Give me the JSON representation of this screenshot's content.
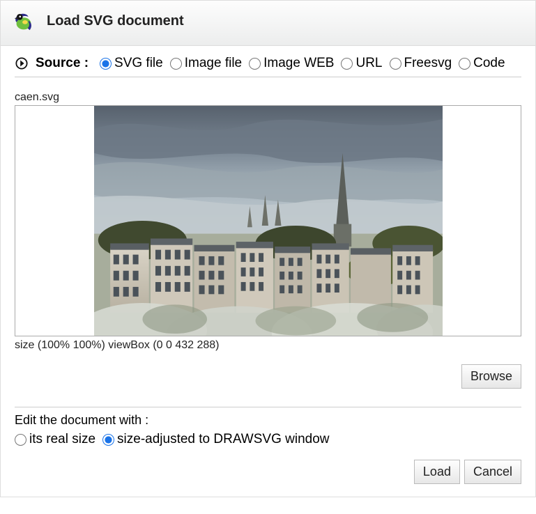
{
  "title": "Load SVG document",
  "source": {
    "label": "Source :",
    "options": [
      {
        "key": "svgfile",
        "label": "SVG file",
        "selected": true
      },
      {
        "key": "imagefile",
        "label": "Image file",
        "selected": false
      },
      {
        "key": "imageweb",
        "label": "Image WEB",
        "selected": false
      },
      {
        "key": "url",
        "label": "URL",
        "selected": false
      },
      {
        "key": "freesvg",
        "label": "Freesvg",
        "selected": false
      },
      {
        "key": "code",
        "label": "Code",
        "selected": false
      }
    ]
  },
  "file": {
    "name": "caen.svg",
    "meta": "size (100% 100%) viewBox (0 0 432 288)"
  },
  "buttons": {
    "browse": "Browse",
    "load": "Load",
    "cancel": "Cancel"
  },
  "edit": {
    "label": "Edit the document with :",
    "options": [
      {
        "key": "realsize",
        "label": "its real size",
        "selected": false
      },
      {
        "key": "adjusted",
        "label": "size-adjusted to DRAWSVG window",
        "selected": true
      }
    ]
  }
}
